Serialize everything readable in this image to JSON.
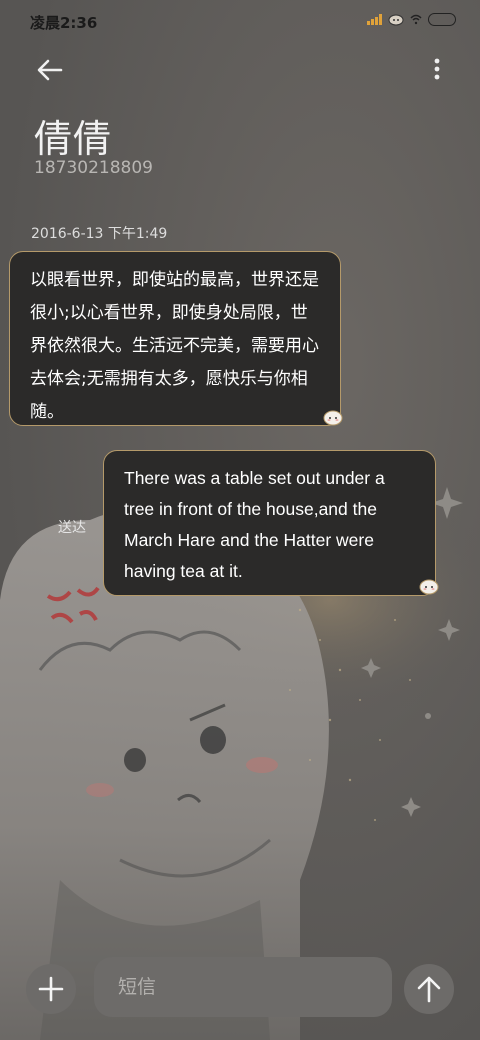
{
  "status_bar": {
    "time": "凌晨2:36",
    "icons": [
      "signal-icon",
      "wifi-icon",
      "battery-icon"
    ]
  },
  "header": {
    "back_icon": "arrow-left-icon",
    "contact_name": "倩倩",
    "phone_number": "18730218809",
    "menu_icon": "more-vertical-icon"
  },
  "conversation": {
    "date": "2016-6-13 下午1:49",
    "messages": [
      {
        "direction": "incoming",
        "text": "以眼看世界，即使站的最高，世界还是很小;以心看世界，即使身处局限，世界依然很大。生活远不完美，需要用心去体会;无需拥有太多，愿快乐与你相随。"
      },
      {
        "direction": "outgoing",
        "text": "There was a table set out under a tree in front of the house,and the March Hare and the Hatter were having tea at it.",
        "status": "送达"
      }
    ]
  },
  "composer": {
    "add_icon": "plus-icon",
    "placeholder": "短信",
    "value": "",
    "send_icon": "arrow-up-icon"
  },
  "colors": {
    "background": "#5a5856",
    "bubble": "#2b2a29",
    "bubble_border": "#b59a6a",
    "button": "#6d6b69"
  }
}
